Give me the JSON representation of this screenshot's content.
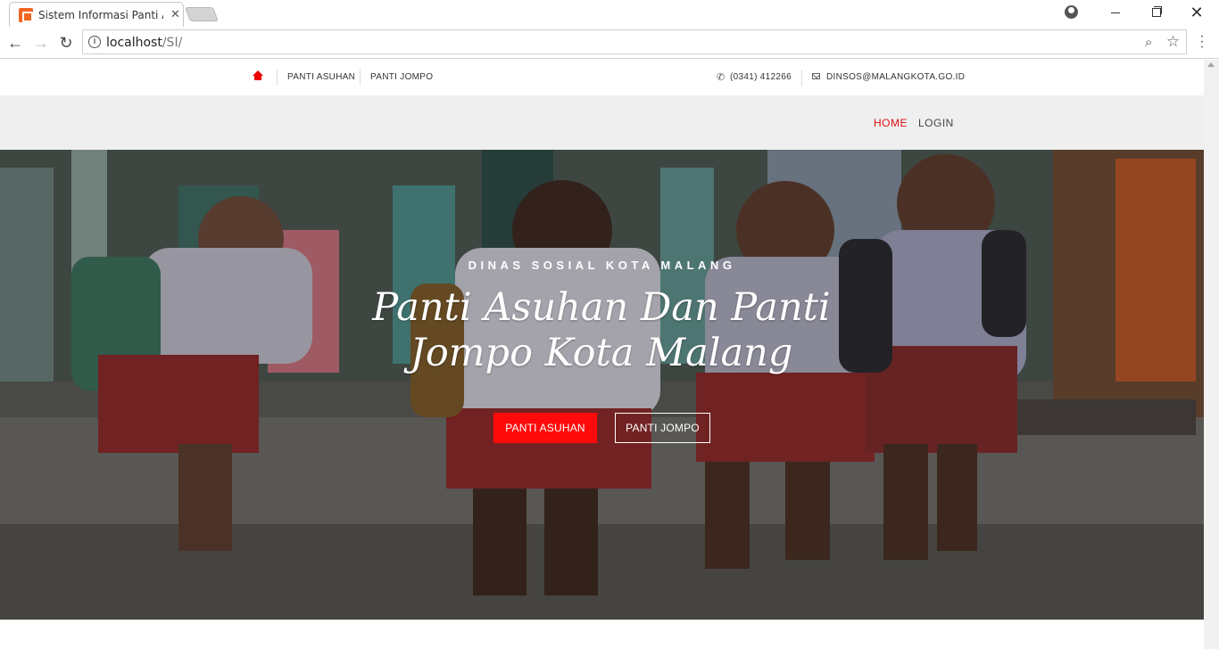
{
  "browser": {
    "tab_title": "Sistem Informasi Panti Asuhan",
    "url_host": "localhost",
    "url_path": "/SI/"
  },
  "topbar": {
    "links": [
      "PANTI ASUHAN",
      "PANTI JOMPO"
    ],
    "phone": "(0341) 412266",
    "email": "DINSOS@MALANGKOTA.GO.ID"
  },
  "navbar": {
    "home": "HOME",
    "login": "LOGIN",
    "active_color": "#e01010"
  },
  "hero": {
    "kicker": "DINAS SOSIAL KOTA MALANG",
    "title": "Panti Asuhan Dan Panti Jompo Kota Malang",
    "primary_button": "PANTI ASUHAN",
    "secondary_button": "PANTI JOMPO",
    "primary_color": "#ff0a0a"
  },
  "icons": {
    "home": "home-icon",
    "phone": "phone-icon",
    "email": "mail-icon"
  }
}
